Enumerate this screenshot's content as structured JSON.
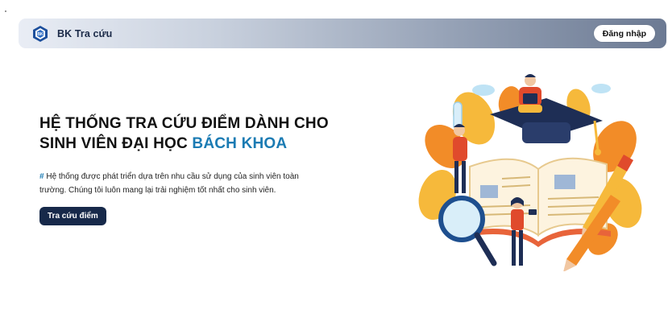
{
  "header": {
    "app_name": "BK Tra cứu",
    "login_label": "Đăng nhập",
    "logo_icon": "bk-logo-icon"
  },
  "hero": {
    "title_main": "HỆ THỐNG TRA CỨU ĐIỂM DÀNH CHO SINH VIÊN ĐẠI HỌC ",
    "title_accent": "BÁCH KHOA",
    "hash_symbol": "#",
    "description": " Hệ thống được phát triển dựa trên nhu cầu sử dụng của sinh viên toàn trường. Chúng tôi luôn mang lại trải nghiệm tốt nhất cho sinh viên.",
    "cta_label": "Tra cứu điểm"
  },
  "colors": {
    "accent": "#1b7bb3",
    "primary_dark": "#17294a",
    "illustration_orange": "#f28c28",
    "illustration_yellow": "#f6b93b",
    "illustration_navy": "#1e2e55"
  },
  "illustration": {
    "icon": "education-illustration"
  }
}
